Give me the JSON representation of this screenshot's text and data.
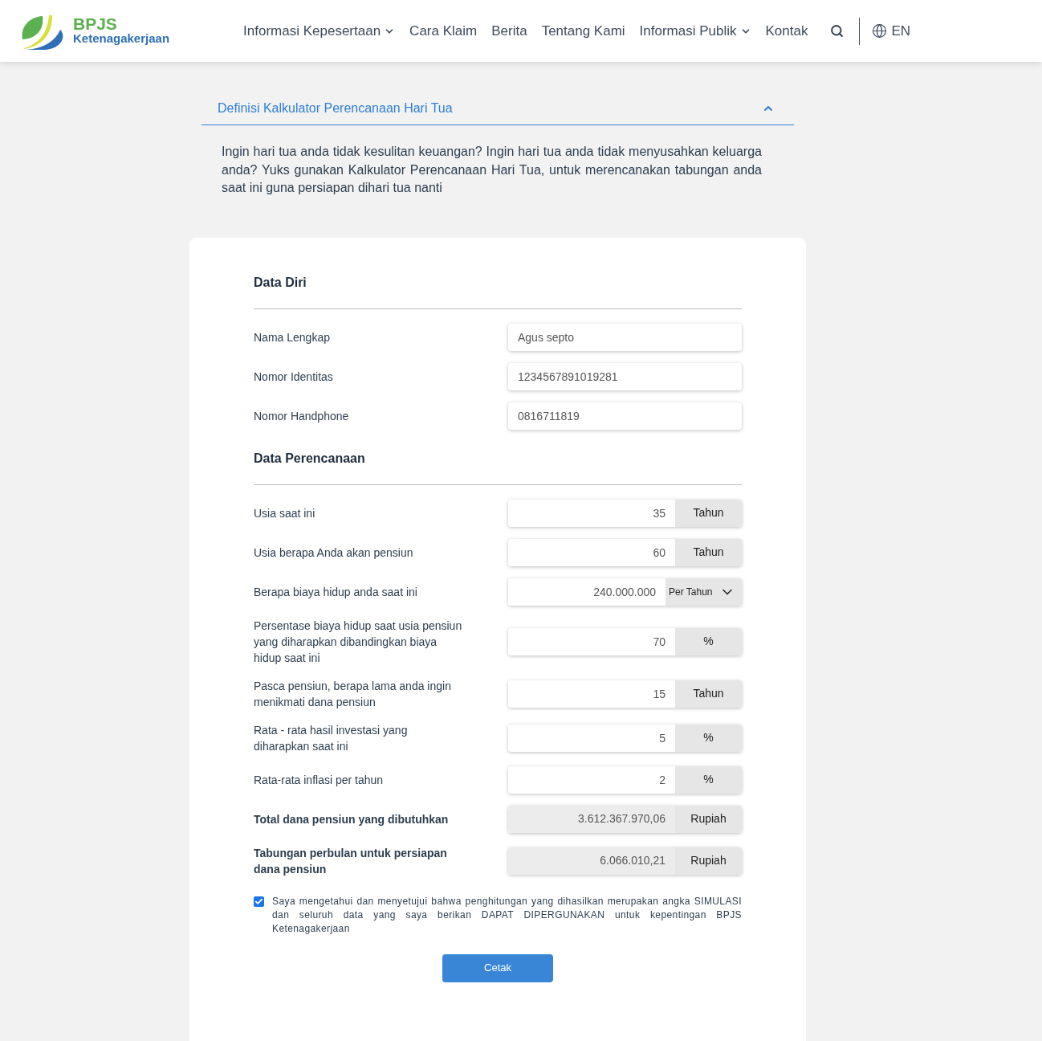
{
  "header": {
    "logo": {
      "name": "BPJS",
      "subtitle": "Ketenagakerjaan"
    },
    "nav": [
      {
        "label": "Informasi Kepesertaan",
        "dropdown": true
      },
      {
        "label": "Cara Klaim",
        "dropdown": false
      },
      {
        "label": "Berita",
        "dropdown": false
      },
      {
        "label": "Tentang Kami",
        "dropdown": false
      },
      {
        "label": "Informasi Publik",
        "dropdown": true
      },
      {
        "label": "Kontak",
        "dropdown": false
      }
    ],
    "language": "EN"
  },
  "accordion": {
    "title": "Definisi Kalkulator Perencanaan Hari Tua",
    "expanded": true,
    "body": "Ingin hari tua anda tidak kesulitan keuangan? Ingin hari tua anda tidak menyusahkan keluarga anda? Yuks gunakan Kalkulator Perencanaan Hari Tua, untuk merencanakan tabungan anda saat ini guna persiapan dihari tua nanti"
  },
  "sections": [
    {
      "title": "Data Diri",
      "fields": [
        {
          "kind": "text",
          "label": "Nama Lengkap",
          "value": "Agus septo"
        },
        {
          "kind": "text",
          "label": "Nomor Identitas",
          "value": "1234567891019281"
        },
        {
          "kind": "text",
          "label": "Nomor Handphone",
          "value": "0816711819"
        }
      ]
    },
    {
      "title": "Data Perencanaan",
      "fields": [
        {
          "kind": "unit",
          "label": "Usia saat ini",
          "value": "35",
          "unit": "Tahun"
        },
        {
          "kind": "unit",
          "label": "Usia berapa Anda akan pensiun",
          "value": "60",
          "unit": "Tahun"
        },
        {
          "kind": "select",
          "label": "Berapa biaya hidup anda saat ini",
          "value": "240.000.000",
          "unit": "Per Tahun"
        },
        {
          "kind": "unit",
          "label": "Persentase biaya hidup saat usia pensiun yang diharapkan dibandingkan biaya hidup saat ini",
          "value": "70",
          "unit": "%"
        },
        {
          "kind": "unit",
          "label": "Pasca pensiun, berapa lama anda ingin menikmati dana pensiun",
          "value": "15",
          "unit": "Tahun"
        },
        {
          "kind": "unit",
          "label": "Rata - rata hasil investasi yang diharapkan saat ini",
          "value": "5",
          "unit": "%"
        },
        {
          "kind": "unit",
          "label": "Rata-rata inflasi per tahun",
          "value": "2",
          "unit": "%"
        },
        {
          "kind": "result",
          "label": "Total dana pensiun yang dibutuhkan",
          "value": "3.612.367.970,06",
          "unit": "Rupiah"
        },
        {
          "kind": "result",
          "label": "Tabungan perbulan untuk persiapan dana pensiun",
          "value": "6.066.010,21",
          "unit": "Rupiah"
        }
      ]
    }
  ],
  "consent": {
    "checked": true,
    "text": "Saya mengetahui dan menyetujui bahwa penghitungan yang dihasilkan merupakan angka SIMULASI dan seluruh data yang saya berikan DAPAT DIPERGUNAKAN untuk kepentingan BPJS Ketenagakerjaan"
  },
  "print_button": "Cetak"
}
